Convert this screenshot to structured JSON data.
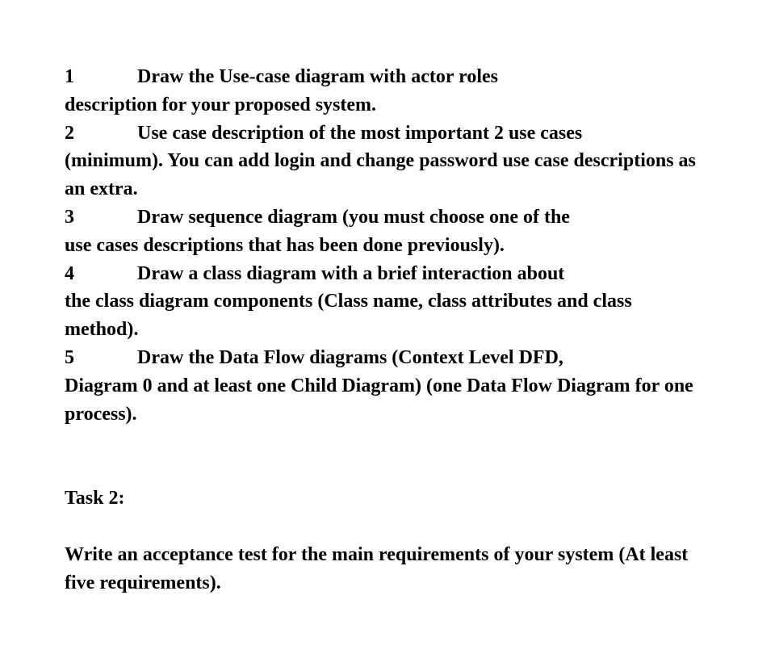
{
  "items": [
    {
      "number": "1",
      "text": "Draw the Use-case diagram with actor roles description for your proposed system."
    },
    {
      "number": "2",
      "text": "Use case description of the most important 2 use cases (minimum). You can add login and change password use case descriptions as an extra."
    },
    {
      "number": "3",
      "text": "Draw sequence diagram (you must choose one of the use cases descriptions that has been done previously)."
    },
    {
      "number": "4",
      "text": "Draw a class diagram with a brief interaction about the class diagram components (Class name, class attributes and class method)."
    },
    {
      "number": "5",
      "text": "Draw the Data Flow diagrams (Context Level DFD, Diagram 0 and at least one Child Diagram) (one Data Flow Diagram for one process)."
    }
  ],
  "task2": {
    "heading": "Task 2:",
    "body": "Write an acceptance test for the main requirements of your system (At least five requirements)."
  }
}
